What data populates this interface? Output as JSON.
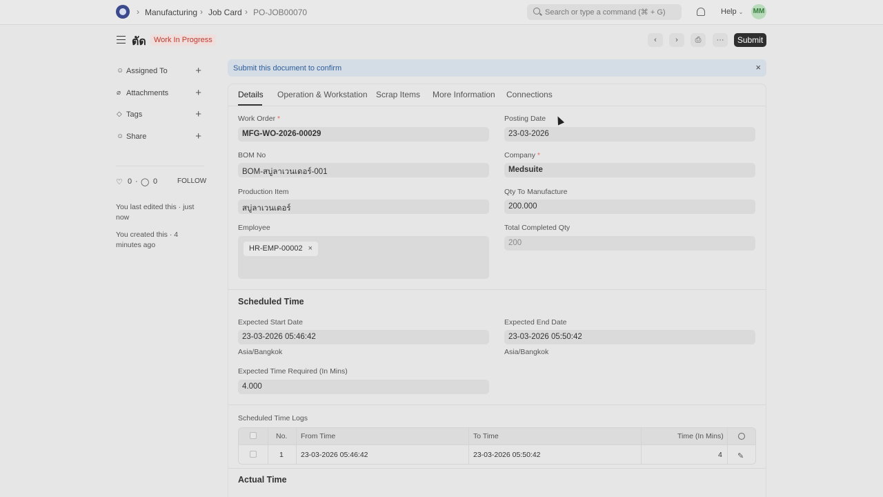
{
  "navbar": {
    "breadcrumbs": [
      "Manufacturing",
      "Job Card",
      "PO-JOB00070"
    ],
    "search_placeholder": "Search or type a command (⌘ + G)",
    "help_label": "Help",
    "avatar_initials": "MM"
  },
  "header": {
    "title": "ตัด",
    "status": "Work In Progress",
    "submit_label": "Submit",
    "more_label": "···"
  },
  "sidebar": {
    "items": [
      {
        "label": "Assigned To",
        "icon": "user-icon"
      },
      {
        "label": "Attachments",
        "icon": "paperclip-icon"
      },
      {
        "label": "Tags",
        "icon": "tag-icon"
      },
      {
        "label": "Share",
        "icon": "share-icon"
      }
    ],
    "likes": "0",
    "comments": "0",
    "follow_label": "FOLLOW",
    "activity": [
      "You last edited this · just now",
      "You created this · 4 minutes ago"
    ]
  },
  "banner": {
    "text": "Submit this document to confirm"
  },
  "tabs": [
    "Details",
    "Operation & Workstation",
    "Scrap Items",
    "More Information",
    "Connections"
  ],
  "fields": {
    "work_order": {
      "label": "Work Order",
      "value": "MFG-WO-2026-00029"
    },
    "posting_date": {
      "label": "Posting Date",
      "value": "23-03-2026"
    },
    "bom_no": {
      "label": "BOM No",
      "value": "BOM-สบู่ลาเวนเดอร์-001"
    },
    "company": {
      "label": "Company",
      "value": "Medsuite"
    },
    "production_item": {
      "label": "Production Item",
      "value": "สบู่ลาเวนเดอร์"
    },
    "qty_to_manufacture": {
      "label": "Qty To Manufacture",
      "value": "200.000"
    },
    "employee": {
      "label": "Employee",
      "value": "HR-EMP-00002"
    },
    "total_completed_qty": {
      "label": "Total Completed Qty",
      "value": "200"
    }
  },
  "scheduled": {
    "title": "Scheduled Time",
    "expected_start": {
      "label": "Expected Start Date",
      "value": "23-03-2026 05:46:42",
      "tz": "Asia/Bangkok"
    },
    "expected_end": {
      "label": "Expected End Date",
      "value": "23-03-2026 05:50:42",
      "tz": "Asia/Bangkok"
    },
    "time_required": {
      "label": "Expected Time Required (In Mins)",
      "value": "4.000"
    },
    "logs_label": "Scheduled Time Logs",
    "columns": [
      "No.",
      "From Time",
      "To Time",
      "Time (In Mins)"
    ],
    "rows": [
      {
        "no": "1",
        "from": "23-03-2026 05:46:42",
        "to": "23-03-2026 05:50:42",
        "mins": "4"
      }
    ]
  },
  "actual": {
    "title": "Actual Time"
  }
}
